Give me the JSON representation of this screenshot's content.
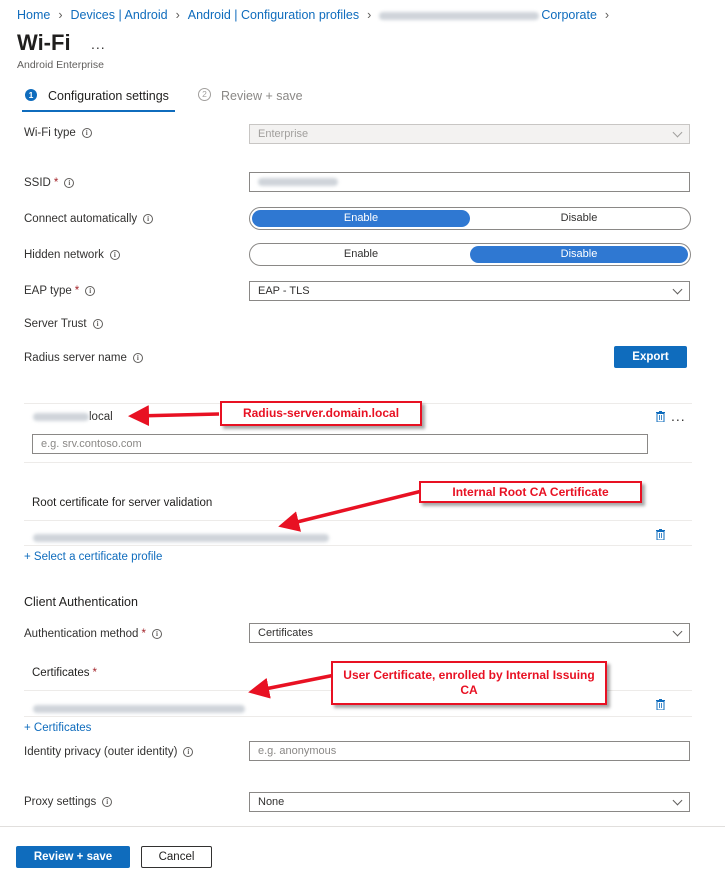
{
  "breadcrumb": {
    "items": [
      "Home",
      "Devices | Android",
      "Android | Configuration profiles",
      "Corporate"
    ]
  },
  "page": {
    "title": "Wi-Fi",
    "more": "...",
    "subtitle": "Android Enterprise"
  },
  "steps": [
    {
      "number": "1",
      "label": "Configuration settings"
    },
    {
      "number": "2",
      "label": "Review + save"
    }
  ],
  "form": {
    "wifi_type": {
      "label": "Wi-Fi type",
      "value": "Enterprise"
    },
    "ssid": {
      "label": "SSID",
      "required": "*"
    },
    "connect_auto": {
      "label": "Connect automatically",
      "enable": "Enable",
      "disable": "Disable",
      "selected": "Enable"
    },
    "hidden_network": {
      "label": "Hidden network",
      "enable": "Enable",
      "disable": "Disable",
      "selected": "Disable"
    },
    "eap_type": {
      "label": "EAP type",
      "required": "*",
      "value": "EAP - TLS"
    },
    "server_trust": {
      "label": "Server Trust"
    },
    "radius_server": {
      "label": "Radius server name",
      "export": "Export",
      "entry_suffix": "local",
      "new_placeholder": "e.g. srv.contoso.com"
    },
    "root_cert": {
      "heading": "Root certificate for server validation",
      "select_link": "+ Select a certificate profile"
    },
    "client_auth": {
      "heading": "Client Authentication"
    },
    "auth_method": {
      "label": "Authentication method",
      "required": "*",
      "value": "Certificates"
    },
    "certificates": {
      "heading": "Certificates",
      "required": "*",
      "add_link": "+ Certificates"
    },
    "identity_privacy": {
      "label": "Identity privacy (outer identity)",
      "placeholder": "e.g. anonymous"
    },
    "proxy": {
      "label": "Proxy settings",
      "value": "None"
    }
  },
  "callouts": {
    "radius": "Radius-server.domain.local",
    "root_ca": "Internal Root CA Certificate",
    "user_cert": "User Certificate, enrolled by Internal Issuing CA"
  },
  "footer": {
    "review_save": "Review + save",
    "cancel": "Cancel"
  },
  "colors": {
    "accent": "#0f6cbd",
    "toggle_on": "#2f78d2",
    "callout": "#e81123"
  },
  "icons": [
    "info-icon",
    "chevron-down-icon",
    "trash-icon",
    "more-icon",
    "chevron-right-icon"
  ]
}
